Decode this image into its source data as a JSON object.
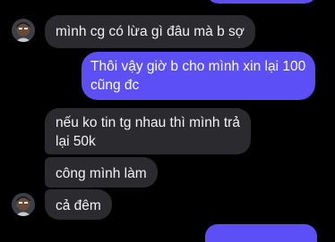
{
  "conversation": {
    "messages": [
      {
        "id": "m0",
        "from": "me",
        "text": ""
      },
      {
        "id": "m1",
        "from": "other",
        "text": "mình cg có lừa gì đâu mà b sợ"
      },
      {
        "id": "m2",
        "from": "me",
        "text_line1": "Thôi vậy giờ b cho mình xin lại 100",
        "text_line2": "cũng đc"
      },
      {
        "id": "m3",
        "from": "other",
        "text_line1": "nếu ko tin tg nhau thì mình trả",
        "text_line2": "lại 50k"
      },
      {
        "id": "m4",
        "from": "other",
        "text": "công mình làm"
      },
      {
        "id": "m5",
        "from": "other",
        "text": "cả đêm"
      },
      {
        "id": "m6",
        "from": "me",
        "text": ""
      }
    ]
  },
  "colors": {
    "incoming_bubble": "#2b2b2f",
    "outgoing_bubble": "#5b4ff5",
    "background": "#000000"
  },
  "icons": [
    "contact-avatar"
  ]
}
